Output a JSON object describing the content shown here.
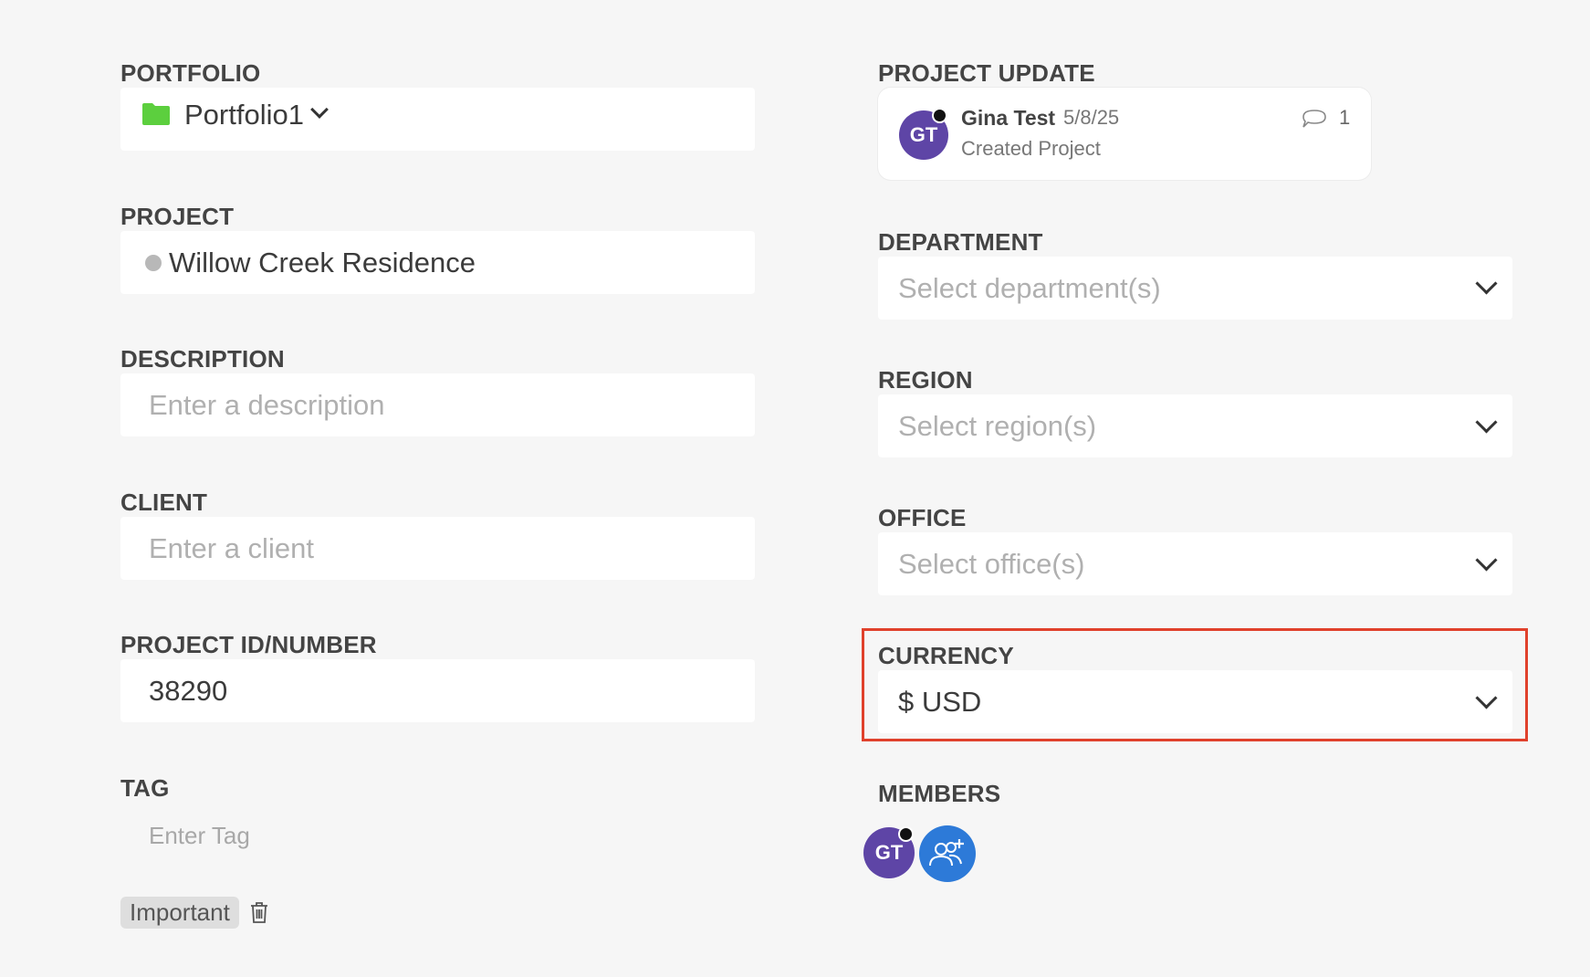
{
  "portfolio": {
    "label": "PORTFOLIO",
    "value": "Portfolio1",
    "icon": "folder-icon",
    "icon_color": "#5ccf3e"
  },
  "project": {
    "label": "PROJECT",
    "value": "Willow Creek Residence",
    "status_color": "#b8b8b8"
  },
  "description": {
    "label": "DESCRIPTION",
    "placeholder": "Enter a description"
  },
  "client": {
    "label": "CLIENT",
    "placeholder": "Enter a client"
  },
  "project_id": {
    "label": "PROJECT ID/NUMBER",
    "value": "38290"
  },
  "tag": {
    "label": "TAG",
    "placeholder": "Enter Tag",
    "chips": [
      "Important"
    ]
  },
  "project_update": {
    "label": "PROJECT UPDATE",
    "avatar_initials": "GT",
    "author": "Gina Test",
    "date": "5/8/25",
    "action": "Created Project",
    "comment_count": "1"
  },
  "department": {
    "label": "DEPARTMENT",
    "placeholder": "Select department(s)"
  },
  "region": {
    "label": "REGION",
    "placeholder": "Select region(s)"
  },
  "office": {
    "label": "OFFICE",
    "placeholder": "Select office(s)"
  },
  "currency": {
    "label": "CURRENCY",
    "value": "$ USD",
    "highlight_color": "#e0412c"
  },
  "members": {
    "label": "MEMBERS",
    "avatars": [
      "GT"
    ],
    "avatar_color": "#5e45a6",
    "add_button_color": "#2d7ad8"
  }
}
